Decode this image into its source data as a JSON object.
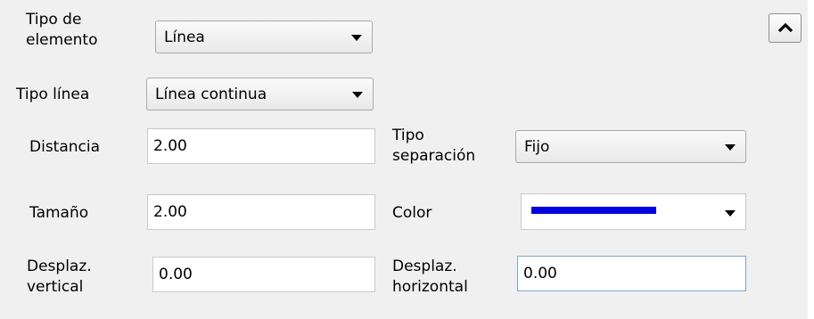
{
  "element_type": {
    "label": "Tipo de\nelemento",
    "value": "Línea"
  },
  "line_type": {
    "label": "Tipo línea",
    "value": "Línea continua"
  },
  "distance": {
    "label": "Distancia",
    "value": "2.00"
  },
  "separation_type": {
    "label": "Tipo\nseparación",
    "value": "Fijo"
  },
  "size": {
    "label": "Tamaño",
    "value": "2.00"
  },
  "color": {
    "label": "Color",
    "swatch": "#0000e0"
  },
  "vertical_offset": {
    "label": "Desplaz.\nvertical",
    "value": "0.00"
  },
  "horizontal_offset": {
    "label": "Desplaz.\nhorizontal",
    "value": "0.00"
  },
  "collapse_button": {
    "icon": "chevron-up-icon"
  }
}
